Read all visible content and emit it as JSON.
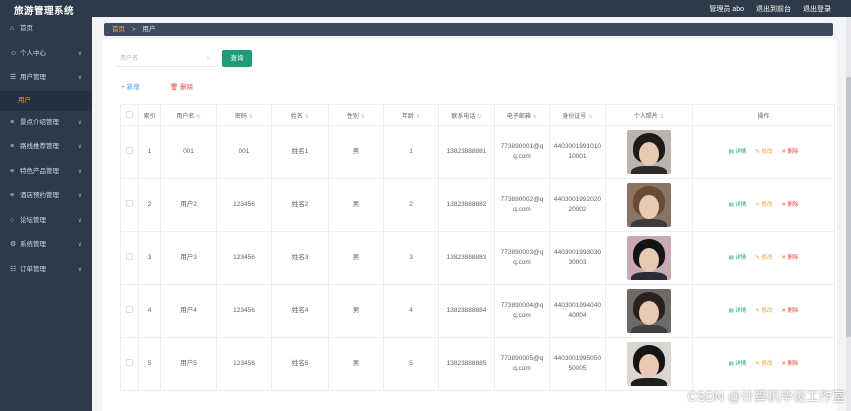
{
  "header": {
    "title": "旅游管理系统",
    "admin_label": "管理员 abo",
    "exit_to_front": "退出到前台",
    "logout": "退出登录"
  },
  "sidebar": {
    "items": [
      {
        "label": "首页",
        "icon": "home-icon",
        "has_arrow": false
      },
      {
        "label": "个人中心",
        "icon": "user-icon",
        "has_arrow": true
      },
      {
        "label": "用户管理",
        "icon": "user-manage-icon",
        "has_arrow": true
      },
      {
        "label": "景点介绍管理",
        "icon": "menu-icon",
        "has_arrow": true
      },
      {
        "label": "路线推荐管理",
        "icon": "menu-icon",
        "has_arrow": true
      },
      {
        "label": "特色产品管理",
        "icon": "menu-icon",
        "has_arrow": true
      },
      {
        "label": "酒店预约管理",
        "icon": "menu-icon",
        "has_arrow": true
      },
      {
        "label": "论坛管理",
        "icon": "forum-icon",
        "has_arrow": true
      },
      {
        "label": "系统管理",
        "icon": "settings-icon",
        "has_arrow": true
      },
      {
        "label": "订单管理",
        "icon": "order-icon",
        "has_arrow": true
      }
    ],
    "submenu_active": "用户"
  },
  "breadcrumb": {
    "home": "首页",
    "current": "用户"
  },
  "search": {
    "placeholder": "用户名",
    "button": "查询"
  },
  "actions": {
    "add": "+ 新增",
    "delete": "删除"
  },
  "table": {
    "headers": [
      "索引",
      "用户名",
      "密码",
      "姓名",
      "性别",
      "年龄",
      "联系电话",
      "电子邮箱",
      "身份证号",
      "个人照片",
      "操作"
    ],
    "rows": [
      {
        "index": "1",
        "username": "001",
        "password": "001",
        "name": "姓名1",
        "gender": "男",
        "age": "1",
        "phone": "13823888881",
        "email": "773890001@qq.com",
        "idcard": "440300199101010001",
        "photo": {
          "hair": "#1b1b1b",
          "body": "#2b2b2b",
          "bg": "#b9b4ad"
        }
      },
      {
        "index": "2",
        "username": "用户2",
        "password": "123456",
        "name": "姓名2",
        "gender": "男",
        "age": "2",
        "phone": "13823888882",
        "email": "773890002@qq.com",
        "idcard": "440300199202020002",
        "photo": {
          "hair": "#6b4a33",
          "body": "#3c3c3c",
          "bg": "#8a7464"
        }
      },
      {
        "index": "3",
        "username": "用户3",
        "password": "123456",
        "name": "姓名3",
        "gender": "男",
        "age": "3",
        "phone": "13823888883",
        "email": "773890003@qq.com",
        "idcard": "440300199303030003",
        "photo": {
          "hair": "#141414",
          "body": "#2a2a38",
          "bg": "#c9a9b2"
        }
      },
      {
        "index": "4",
        "username": "用户4",
        "password": "123456",
        "name": "姓名4",
        "gender": "男",
        "age": "4",
        "phone": "13823888884",
        "email": "773890004@qq.com",
        "idcard": "440300199404040004",
        "photo": {
          "hair": "#2a211d",
          "body": "#3f3f3f",
          "bg": "#6f6a66"
        }
      },
      {
        "index": "5",
        "username": "用户5",
        "password": "123456",
        "name": "姓名5",
        "gender": "男",
        "age": "5",
        "phone": "13823888885",
        "email": "773890005@qq.com",
        "idcard": "440300199505050005",
        "photo": {
          "hair": "#151515",
          "body": "#1e1e1e",
          "bg": "#d9d6d2"
        }
      }
    ],
    "ops": {
      "detail": "详情",
      "edit": "修改",
      "delete": "删除"
    }
  },
  "watermark": "CSDN @计算机毕设工作室"
}
